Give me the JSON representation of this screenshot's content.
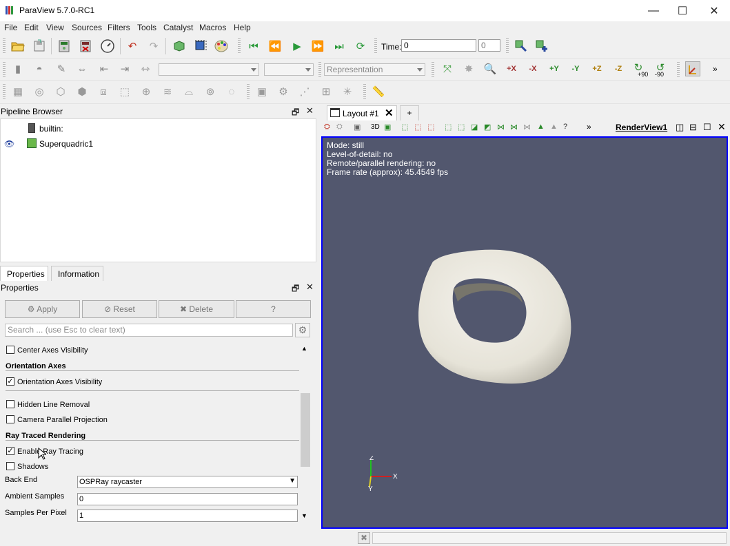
{
  "window": {
    "title": "ParaView 5.7.0-RC1",
    "minimize": "—",
    "maximize": "☐",
    "close": "✕"
  },
  "menu": [
    "File",
    "Edit",
    "View",
    "Sources",
    "Filters",
    "Tools",
    "Catalyst",
    "Macros",
    "Help"
  ],
  "time": {
    "label": "Time:",
    "value": "0",
    "index": "0"
  },
  "toolbar2": {
    "representation_placeholder": "Representation",
    "rotate_plus": "+90",
    "rotate_minus": "-90",
    "axis_labels": [
      "+X",
      "-X",
      "+Y",
      "-Y",
      "+Z",
      "-Z"
    ]
  },
  "pipeline": {
    "title": "Pipeline Browser",
    "items": [
      "builtin:",
      "Superquadric1"
    ]
  },
  "tabs": [
    "Properties",
    "Information"
  ],
  "properties": {
    "title": "Properties",
    "buttons": {
      "apply": "Apply",
      "reset": "Reset",
      "delete": "Delete",
      "help": "?"
    },
    "search_placeholder": "Search ... (use Esc to clear text)",
    "center_axes": "Center Axes Visibility",
    "orientation_section": "Orientation Axes",
    "orientation_visibility": "Orientation Axes Visibility",
    "hidden_line": "Hidden Line Removal",
    "camera_parallel": "Camera Parallel Projection",
    "ray_section": "Ray Traced Rendering",
    "enable_ray": "Enable Ray Tracing",
    "shadows": "Shadows",
    "back_end_label": "Back End",
    "back_end_value": "OSPRay raycaster",
    "ambient_label": "Ambient Samples",
    "ambient_value": "0",
    "spp_label": "Samples Per Pixel",
    "spp_value": "1"
  },
  "layout": {
    "tab": "Layout #1",
    "add": "+",
    "view_name": "RenderView1",
    "btn_3d": "3D",
    "more": "»"
  },
  "render": {
    "line1": "Mode: still",
    "line2": "Level-of-detail: no",
    "line3": "Remote/parallel rendering: no",
    "line4": "Frame rate (approx): 45.4549 fps",
    "bg_color": "#52576e",
    "axis_x": "X",
    "axis_y": "Y",
    "axis_z": "Z"
  }
}
